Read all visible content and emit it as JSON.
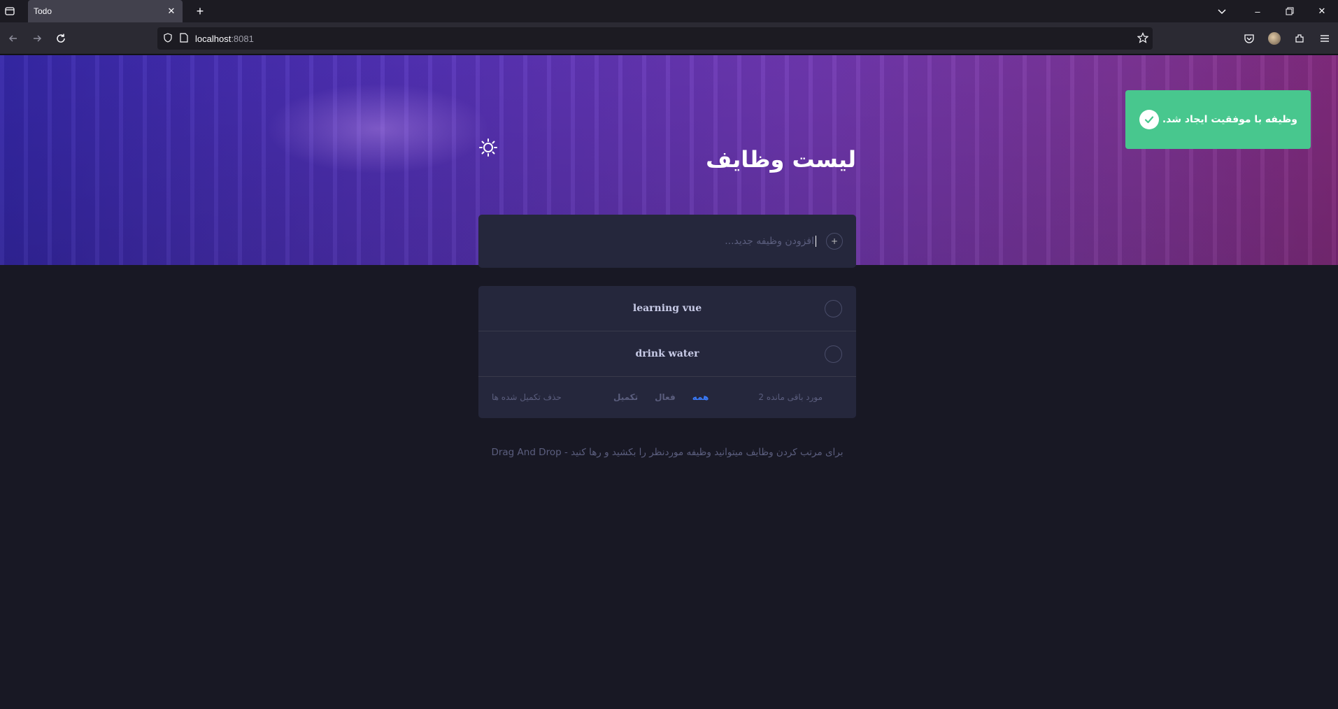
{
  "browser": {
    "tab_title": "Todo",
    "url_host": "localhost",
    "url_port": ":8081"
  },
  "app": {
    "title": "لیست وظایف",
    "new_todo_placeholder": "افزودن وظیفه جدید...",
    "add_icon": "+",
    "todos": [
      {
        "text": "learning vue",
        "completed": false
      },
      {
        "text": "drink water",
        "completed": false
      }
    ],
    "footer": {
      "items_left": "2 مورد باقی مانده",
      "filters": [
        "همه",
        "فعال",
        "تکمیل"
      ],
      "active_filter": "همه",
      "clear_completed": "حذف تکمیل شده ها"
    },
    "hint": "برای مرتب کردن وظایف میتوانید وظیفه موردنظر را بکشید و رها کنید - Drag And Drop"
  },
  "toast": {
    "message": "وظیفه با موفقیت ایجاد شد.",
    "color": "#48c78e"
  },
  "colors": {
    "accent": "#3a7cfd",
    "card": "#25273c",
    "background": "#181824"
  }
}
